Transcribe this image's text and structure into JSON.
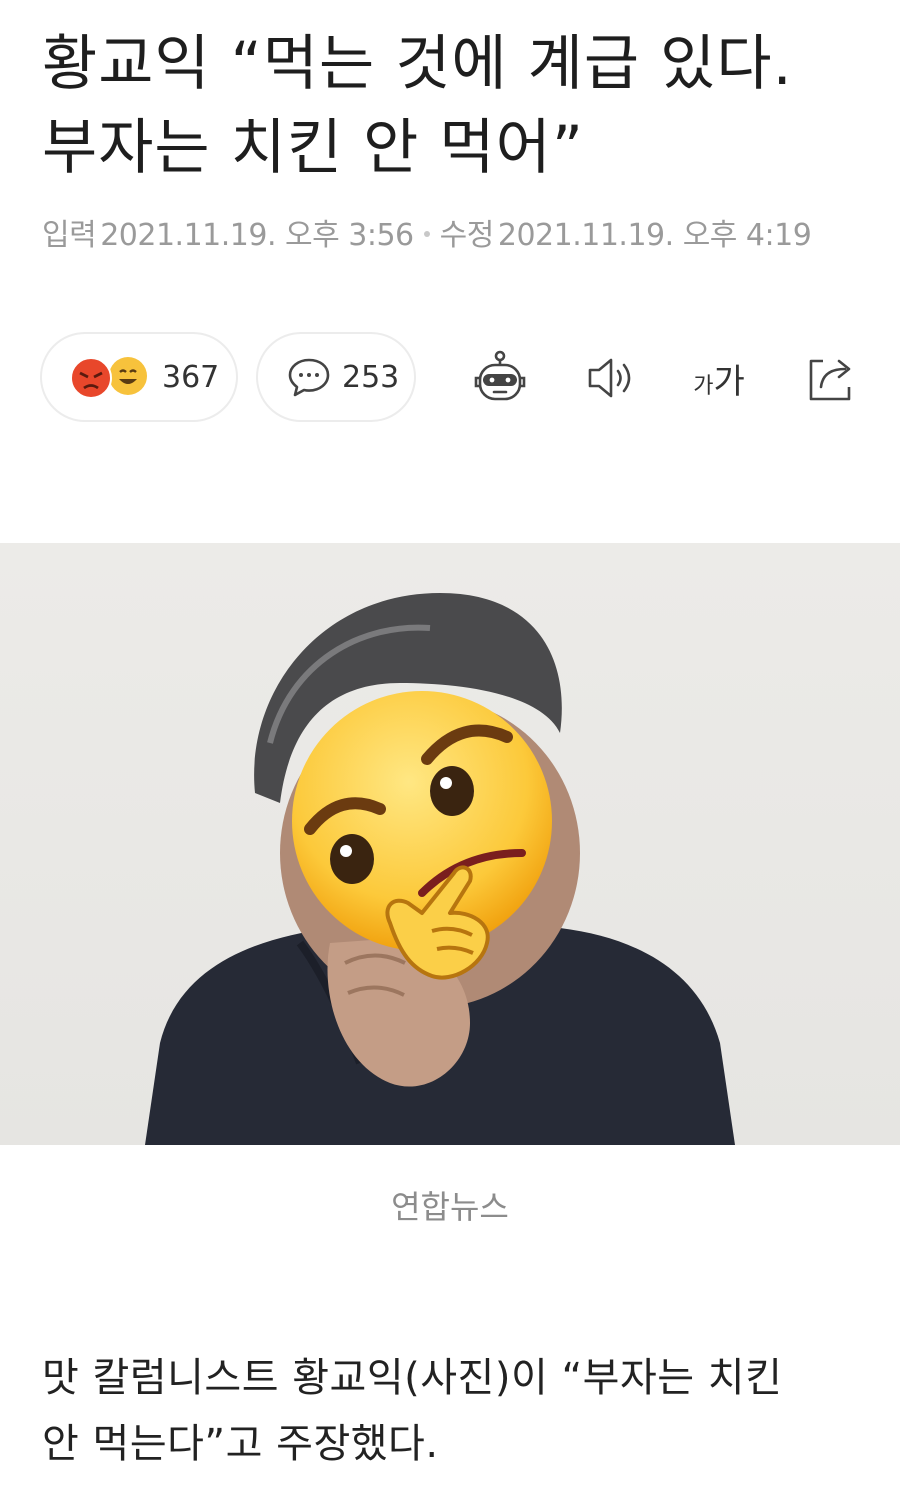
{
  "article": {
    "title_line1": "황교익 “먹는 것에 계급 있다.",
    "title_line2": "부자는 치킨 안 먹어”",
    "input_label": "입력",
    "input_time": "2021.11.19. 오후 3:56",
    "edit_label": "수정",
    "edit_time": "2021.11.19. 오후 4:19"
  },
  "toolbar": {
    "reaction_count": "367",
    "comment_count": "253",
    "font_size_small": "가",
    "font_size_large": "가",
    "icons": [
      "angry-emoji-icon",
      "laughing-emoji-icon",
      "comment-bubble-icon",
      "robot-summary-icon",
      "speaker-icon",
      "font-size-icon",
      "share-icon"
    ]
  },
  "photo": {
    "caption": "연합뉴스",
    "description_icon": "thinking-face-emoji"
  },
  "body": {
    "line1": "맛 칼럼니스트 황교익(사진)이 “부자는 치킨",
    "line2": "안 먹는다”고 주장했다."
  },
  "colors": {
    "accent_angry": "#e8472b",
    "accent_smile": "#f7c23c",
    "meta_gray": "#9a9a9a"
  }
}
